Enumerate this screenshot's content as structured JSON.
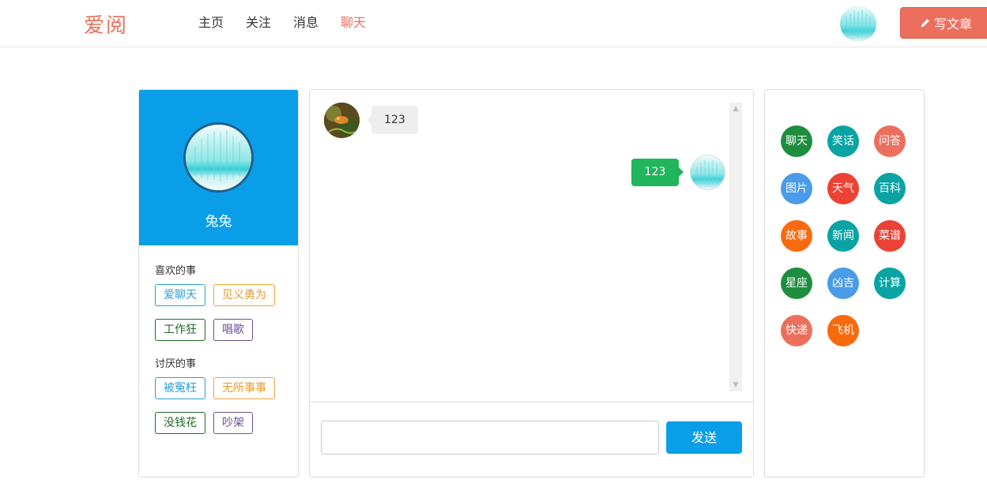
{
  "header": {
    "logo": "爱阅",
    "nav": [
      {
        "label": "主页"
      },
      {
        "label": "关注"
      },
      {
        "label": "消息"
      },
      {
        "label": "聊天",
        "active": true
      }
    ],
    "write_button": "写文章",
    "accent_color": "#ea6f5a"
  },
  "profile": {
    "name": "兔兔",
    "likes_title": "喜欢的事",
    "likes": [
      "爱聊天",
      "见义勇为",
      "工作狂",
      "唱歌"
    ],
    "dislikes_title": "讨厌的事",
    "dislikes": [
      "被冤枉",
      "无所事事",
      "没钱花",
      "吵架"
    ],
    "banner_color": "#0a9ee8"
  },
  "chat": {
    "messages": [
      {
        "side": "left",
        "text": "123"
      },
      {
        "side": "right",
        "text": "123"
      }
    ],
    "input_value": "",
    "send_button": "发送"
  },
  "services": [
    {
      "label": "聊天",
      "color": "#1e8e3e"
    },
    {
      "label": "笑话",
      "color": "#0aa3a3"
    },
    {
      "label": "问答",
      "color": "#ec6f5e"
    },
    {
      "label": "图片",
      "color": "#4a9be8"
    },
    {
      "label": "天气",
      "color": "#ec4135"
    },
    {
      "label": "百科",
      "color": "#0aa3a3"
    },
    {
      "label": "故事",
      "color": "#f96a0e"
    },
    {
      "label": "新闻",
      "color": "#0aa3a3"
    },
    {
      "label": "菜谱",
      "color": "#ec4135"
    },
    {
      "label": "星座",
      "color": "#1e8e3e"
    },
    {
      "label": "凶吉",
      "color": "#4a9be8"
    },
    {
      "label": "计算",
      "color": "#0aa3a3"
    },
    {
      "label": "快递",
      "color": "#ec6f5e"
    },
    {
      "label": "飞机",
      "color": "#f96a0e"
    }
  ]
}
